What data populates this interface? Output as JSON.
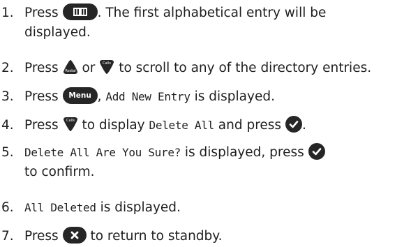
{
  "steps": [
    {
      "num": "1.",
      "t1": "Press",
      "t2": ". The first alphabetical entry will be",
      "t3": "displayed."
    },
    {
      "num": "2.",
      "t1": "Press",
      "t2": "or",
      "t3": "to scroll to any of the directory entries."
    },
    {
      "num": "3.",
      "t1": "Press",
      "t2": ",",
      "lcd": "Add New Entry",
      "t3": "is displayed."
    },
    {
      "num": "4.",
      "t1": "Press",
      "t2": "to display",
      "lcd": "Delete All",
      "t3": "and press",
      "t4": "."
    },
    {
      "num": "5.",
      "lcd": "Delete All Are You Sure?",
      "t1": "is displayed, press",
      "t2": "to confirm."
    },
    {
      "num": "6.",
      "lcd": "All Deleted",
      "t1": "is displayed."
    },
    {
      "num": "7.",
      "t1": "Press",
      "t2": "to return to standby."
    }
  ],
  "buttons": {
    "menu_label": "Menu",
    "redial_label": "Redial",
    "calls_label": "Calls"
  },
  "icons": {
    "phonebook": "book-icon",
    "up": "redial-up-icon",
    "down": "calls-down-icon",
    "ok": "checkmark-icon",
    "cancel": "cross-icon"
  },
  "colors": {
    "text": "#1e1e1e",
    "button": "#262626",
    "button_text": "#ffffff"
  }
}
